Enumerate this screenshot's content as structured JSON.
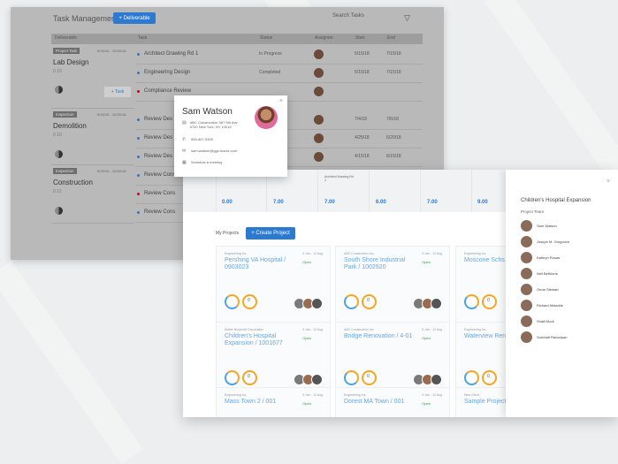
{
  "task_window": {
    "title": "Task Management",
    "add_deliverable": "+ Deliverable",
    "search_placeholder": "Search Tasks",
    "columns": [
      "Deliverable",
      "Task",
      "Status",
      "Assignee",
      "Start",
      "End"
    ],
    "deliverables": [
      {
        "tag": "Project Task",
        "dates": "5/15/18 - 10/30/18",
        "name": "Lab Design",
        "sub": "0 10"
      },
      {
        "tag": "Inspection",
        "dates": "5/15/18 - 10/30/18",
        "name": "Demolition",
        "sub": "0 10"
      },
      {
        "tag": "Inspection",
        "dates": "5/15/18 - 10/30/18",
        "name": "Construction",
        "sub": "0 11"
      }
    ],
    "add_task": "+ Task",
    "tasks": [
      {
        "name": "Architect Drawing Rd 1",
        "status": "In Progress",
        "start": "5/15/18",
        "end": "7/15/18",
        "color": "#2b79d1"
      },
      {
        "name": "Engineering Design",
        "status": "Completed",
        "start": "5/15/18",
        "end": "7/15/18",
        "color": "#2b79d1"
      },
      {
        "name": "Compliance Review",
        "status": "",
        "start": "",
        "end": "",
        "color": "#d0021b"
      },
      {
        "name": "Review Des",
        "status": "",
        "start": "7/4/18",
        "end": "7/6/18",
        "color": "#2b79d1"
      },
      {
        "name": "Review Des",
        "status": "",
        "start": "4/25/18",
        "end": "6/20/18",
        "color": "#2b79d1"
      },
      {
        "name": "Review Des",
        "status": "",
        "start": "4/15/18",
        "end": "6/15/18",
        "color": "#2b79d1"
      },
      {
        "name": "Review Cons",
        "status": "",
        "start": "",
        "end": "",
        "color": "#2b79d1"
      },
      {
        "name": "Review Cons",
        "status": "",
        "start": "",
        "end": "",
        "color": "#d0021b"
      },
      {
        "name": "Review Cons",
        "status": "",
        "start": "",
        "end": "",
        "color": "#2b79d1"
      }
    ]
  },
  "contact_card": {
    "name": "Sam Watson",
    "address": "ABC Construction 587 5th Ave #700 New York, NY 10016",
    "phone": "555-867-5309",
    "email": "sam.watson@ggc-works.com",
    "schedule": "Schedule a meeting",
    "close": "×"
  },
  "projects_window": {
    "timeline_label": "Architect Drawing Rd 1",
    "timeline_values": [
      "0.00",
      "7.00",
      "7.00",
      "6.00",
      "7.00",
      "9.00"
    ],
    "my_projects": "My Projects",
    "create_project": "+ Create Project",
    "projects": [
      {
        "org": "Engineering Inc.",
        "title": "Pershing VA Hospital / 0903023",
        "meta": "5 Jan - 12 Aug",
        "status": "Open"
      },
      {
        "org": "ABC Construction Inc.",
        "title": "South Shore Industrial Park / 1002520",
        "meta": "5 Jan - 12 Aug",
        "status": "Open"
      },
      {
        "org": "Engineering Inc.",
        "title": "Moscone Schs",
        "meta": "",
        "status": ""
      },
      {
        "org": "Mathe Nonprofit Corporation",
        "title": "Children's Hospital Expansion / 1001677",
        "meta": "5 Jan - 12 Aug",
        "status": "Open"
      },
      {
        "org": "ABC Construction Inc.",
        "title": "Bridge Renovation / 4-01",
        "meta": "5 Jan - 12 Aug",
        "status": "Open"
      },
      {
        "org": "Engineering Inc.",
        "title": "Waterview Reno",
        "meta": "",
        "status": ""
      },
      {
        "org": "Engineering Inc.",
        "title": "Mass Town 2 / 001",
        "meta": "5 Jan - 12 Aug",
        "status": "Open"
      },
      {
        "org": "Engineering Inc.",
        "title": "Dorest MA Town / 001",
        "meta": "5 Jan - 12 Aug",
        "status": "Open"
      },
      {
        "org": "New Client",
        "title": "Sample Project",
        "meta": "",
        "status": ""
      }
    ],
    "side_panel": {
      "title": "Children's Hospital Expansion",
      "team_label": "Project Team",
      "close": "×",
      "members": [
        "Sam Watson",
        "Joseph M. Gregorich",
        "Kathryn Rosas",
        "Neil Bethlone",
        "Omar Stewart",
        "Richard Malarkle",
        "Shaili Modi",
        "Surbhati Ranaripan"
      ]
    }
  }
}
